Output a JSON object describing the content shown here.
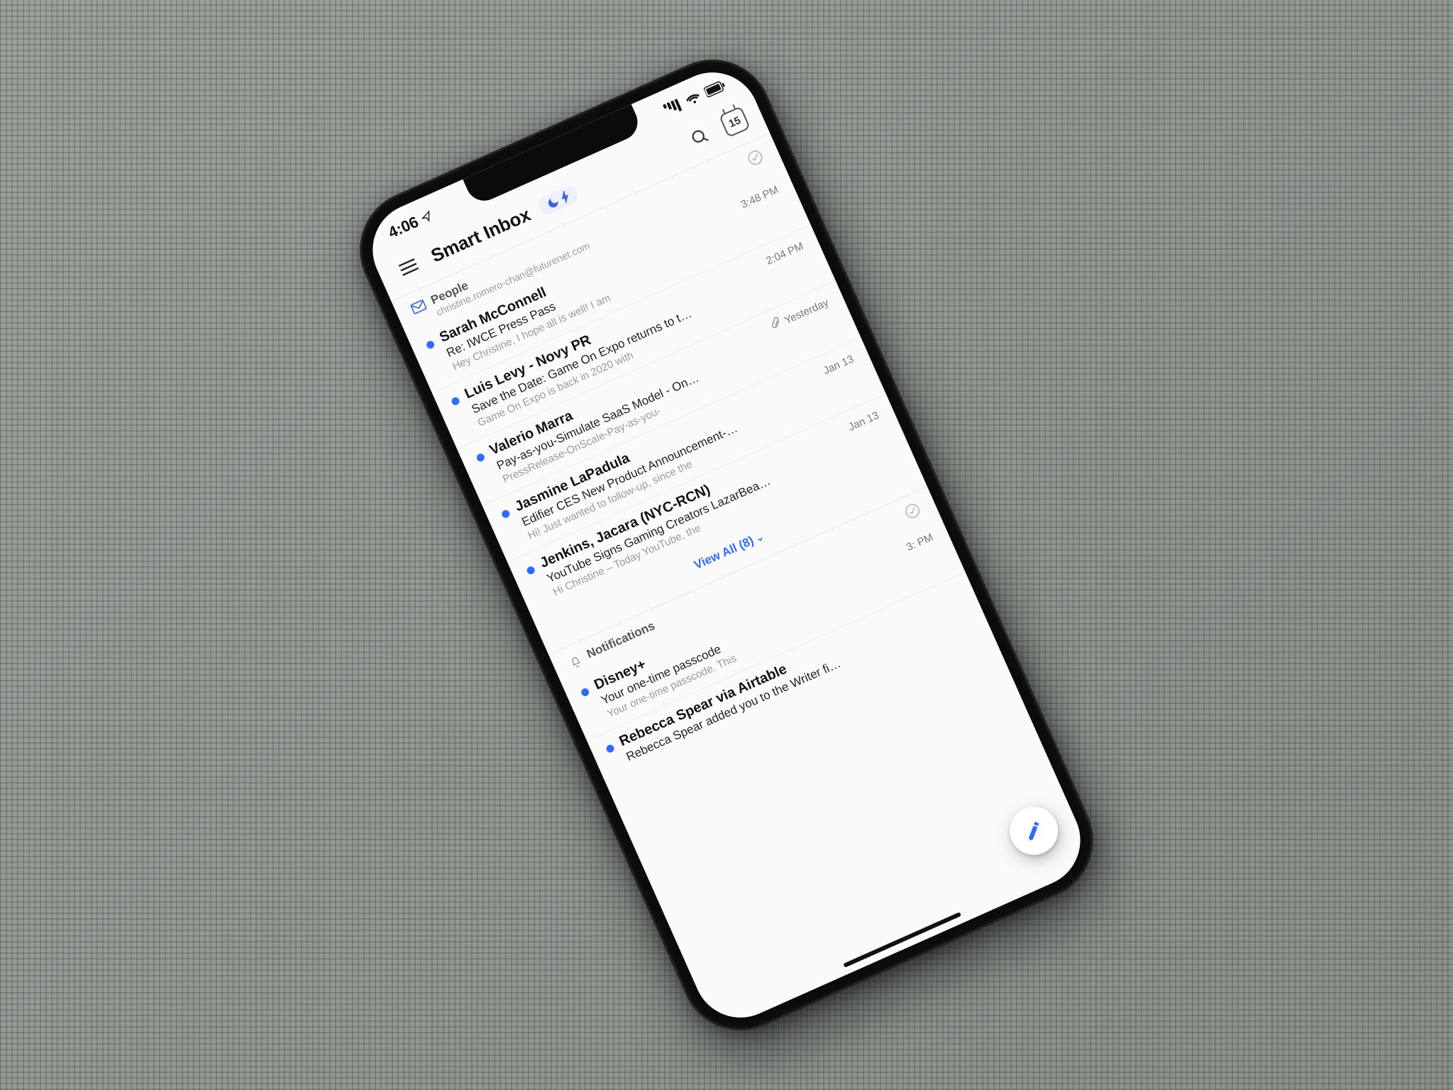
{
  "status": {
    "time": "4:06",
    "calendar_day": "15"
  },
  "header": {
    "title": "Smart Inbox"
  },
  "sections": {
    "people": {
      "name": "People",
      "account": "christine.romero-chan@futurenet.com",
      "view_all_label": "View All (8)",
      "emails": [
        {
          "sender": "Sarah McConnell",
          "time": "3:48 PM",
          "subject": "Re: IWCE Press Pass",
          "preview": "Hey Christine, I hope all is well! I am",
          "unread": true,
          "attachment": false
        },
        {
          "sender": "Luis Levy - Novy PR",
          "time": "2:04 PM",
          "subject": "Save the Date: Game On Expo returns to t…",
          "preview": "Game On Expo is back in 2020 with",
          "unread": true,
          "attachment": false
        },
        {
          "sender": "Valerio Marra",
          "time": "Yesterday",
          "subject": "Pay-as-you-Simulate SaaS Model - On…",
          "preview": "PressRelease-OnScale-Pay-as-you-",
          "unread": true,
          "attachment": true
        },
        {
          "sender": "Jasmine LaPadula",
          "time": "Jan 13",
          "subject": "Edifier CES New Product Announcement-…",
          "preview": "Hi! Just wanted to follow-up, since the",
          "unread": true,
          "attachment": false
        },
        {
          "sender": "Jenkins, Jacara (NYC-RCN)",
          "time": "Jan 13",
          "subject": "YouTube Signs Gaming Creators LazarBea…",
          "preview": "Hi Christine – Today YouTube, the",
          "unread": true,
          "attachment": false
        }
      ]
    },
    "notifications": {
      "name": "Notifications",
      "emails": [
        {
          "sender": "Disney+",
          "time": "3:   PM",
          "subject": "Your one-time passcode",
          "preview": "Your one-time passcode. This",
          "unread": true,
          "attachment": false
        },
        {
          "sender": "Rebecca Spear via Airtable",
          "time": "",
          "subject": "Rebecca Spear added you to the Writer fi…",
          "preview": "",
          "unread": true,
          "attachment": false
        }
      ]
    }
  }
}
